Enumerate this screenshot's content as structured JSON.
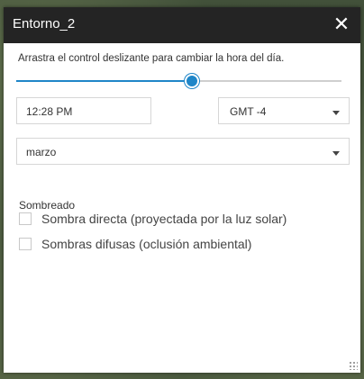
{
  "window": {
    "title": "Entorno_2",
    "close_icon": "close-icon"
  },
  "time_slider": {
    "instruction": "Arrastra el control deslizante para cambiar la hora del día.",
    "value_fraction": 0.54
  },
  "time": {
    "value": "12:28 PM"
  },
  "timezone": {
    "selected": "GMT -4"
  },
  "month": {
    "selected": "marzo"
  },
  "shading": {
    "section_label": "Sombreado",
    "options": [
      {
        "label": "Sombra directa (proyectada por la luz solar)",
        "checked": false
      },
      {
        "label": "Sombras difusas (oclusión ambiental)",
        "checked": false
      }
    ]
  },
  "colors": {
    "titlebar": "#242424",
    "accent": "#1f86c8"
  }
}
